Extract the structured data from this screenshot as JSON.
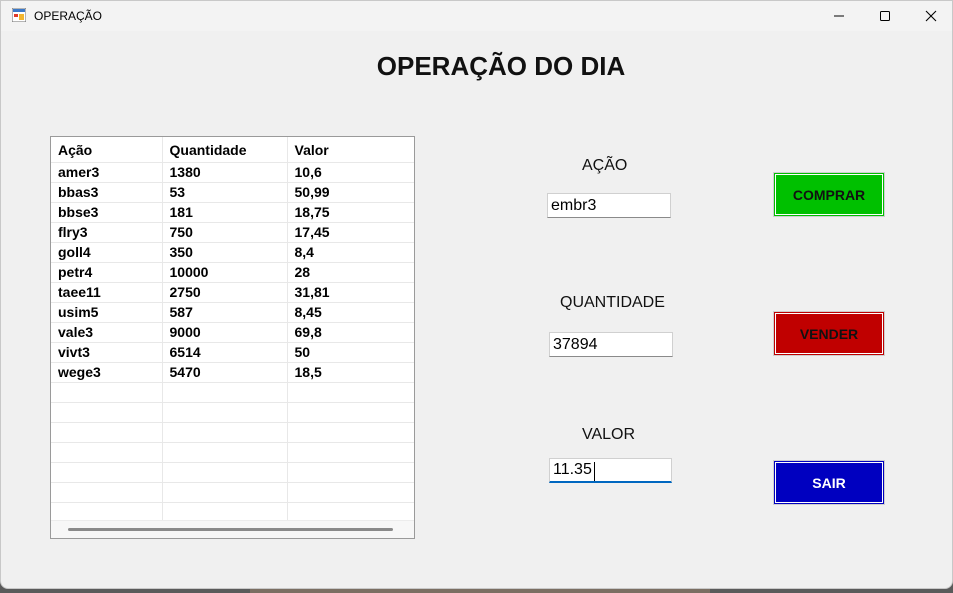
{
  "window": {
    "title": "OPERAÇÃO",
    "icon": "winforms-app-icon",
    "controls": [
      "minimize-icon",
      "maximize-icon",
      "close-icon"
    ]
  },
  "page_title": "OPERAÇÃO DO DIA",
  "grid": {
    "headers": [
      "Ação",
      "Quantidade",
      "Valor"
    ],
    "rows": [
      [
        "amer3",
        "1380",
        "10,6"
      ],
      [
        "bbas3",
        "53",
        "50,99"
      ],
      [
        "bbse3",
        "181",
        "18,75"
      ],
      [
        "flry3",
        "750",
        "17,45"
      ],
      [
        "goll4",
        "350",
        "8,4"
      ],
      [
        "petr4",
        "10000",
        "28"
      ],
      [
        "taee11",
        "2750",
        "31,81"
      ],
      [
        "usim5",
        "587",
        "8,45"
      ],
      [
        "vale3",
        "9000",
        "69,8"
      ],
      [
        "vivt3",
        "6514",
        "50"
      ],
      [
        "wege3",
        "5470",
        "18,5"
      ]
    ],
    "empty_rows": 7
  },
  "form": {
    "acao": {
      "label": "AÇÃO",
      "value": "embr3"
    },
    "quantidade": {
      "label": "QUANTIDADE",
      "value": "37894"
    },
    "valor": {
      "label": "VALOR",
      "value": "11.35"
    }
  },
  "buttons": {
    "comprar": {
      "label": "COMPRAR",
      "color": "#00c000"
    },
    "vender": {
      "label": "VENDER",
      "color": "#c00000"
    },
    "sair": {
      "label": "SAIR",
      "color": "#0000c0"
    }
  }
}
